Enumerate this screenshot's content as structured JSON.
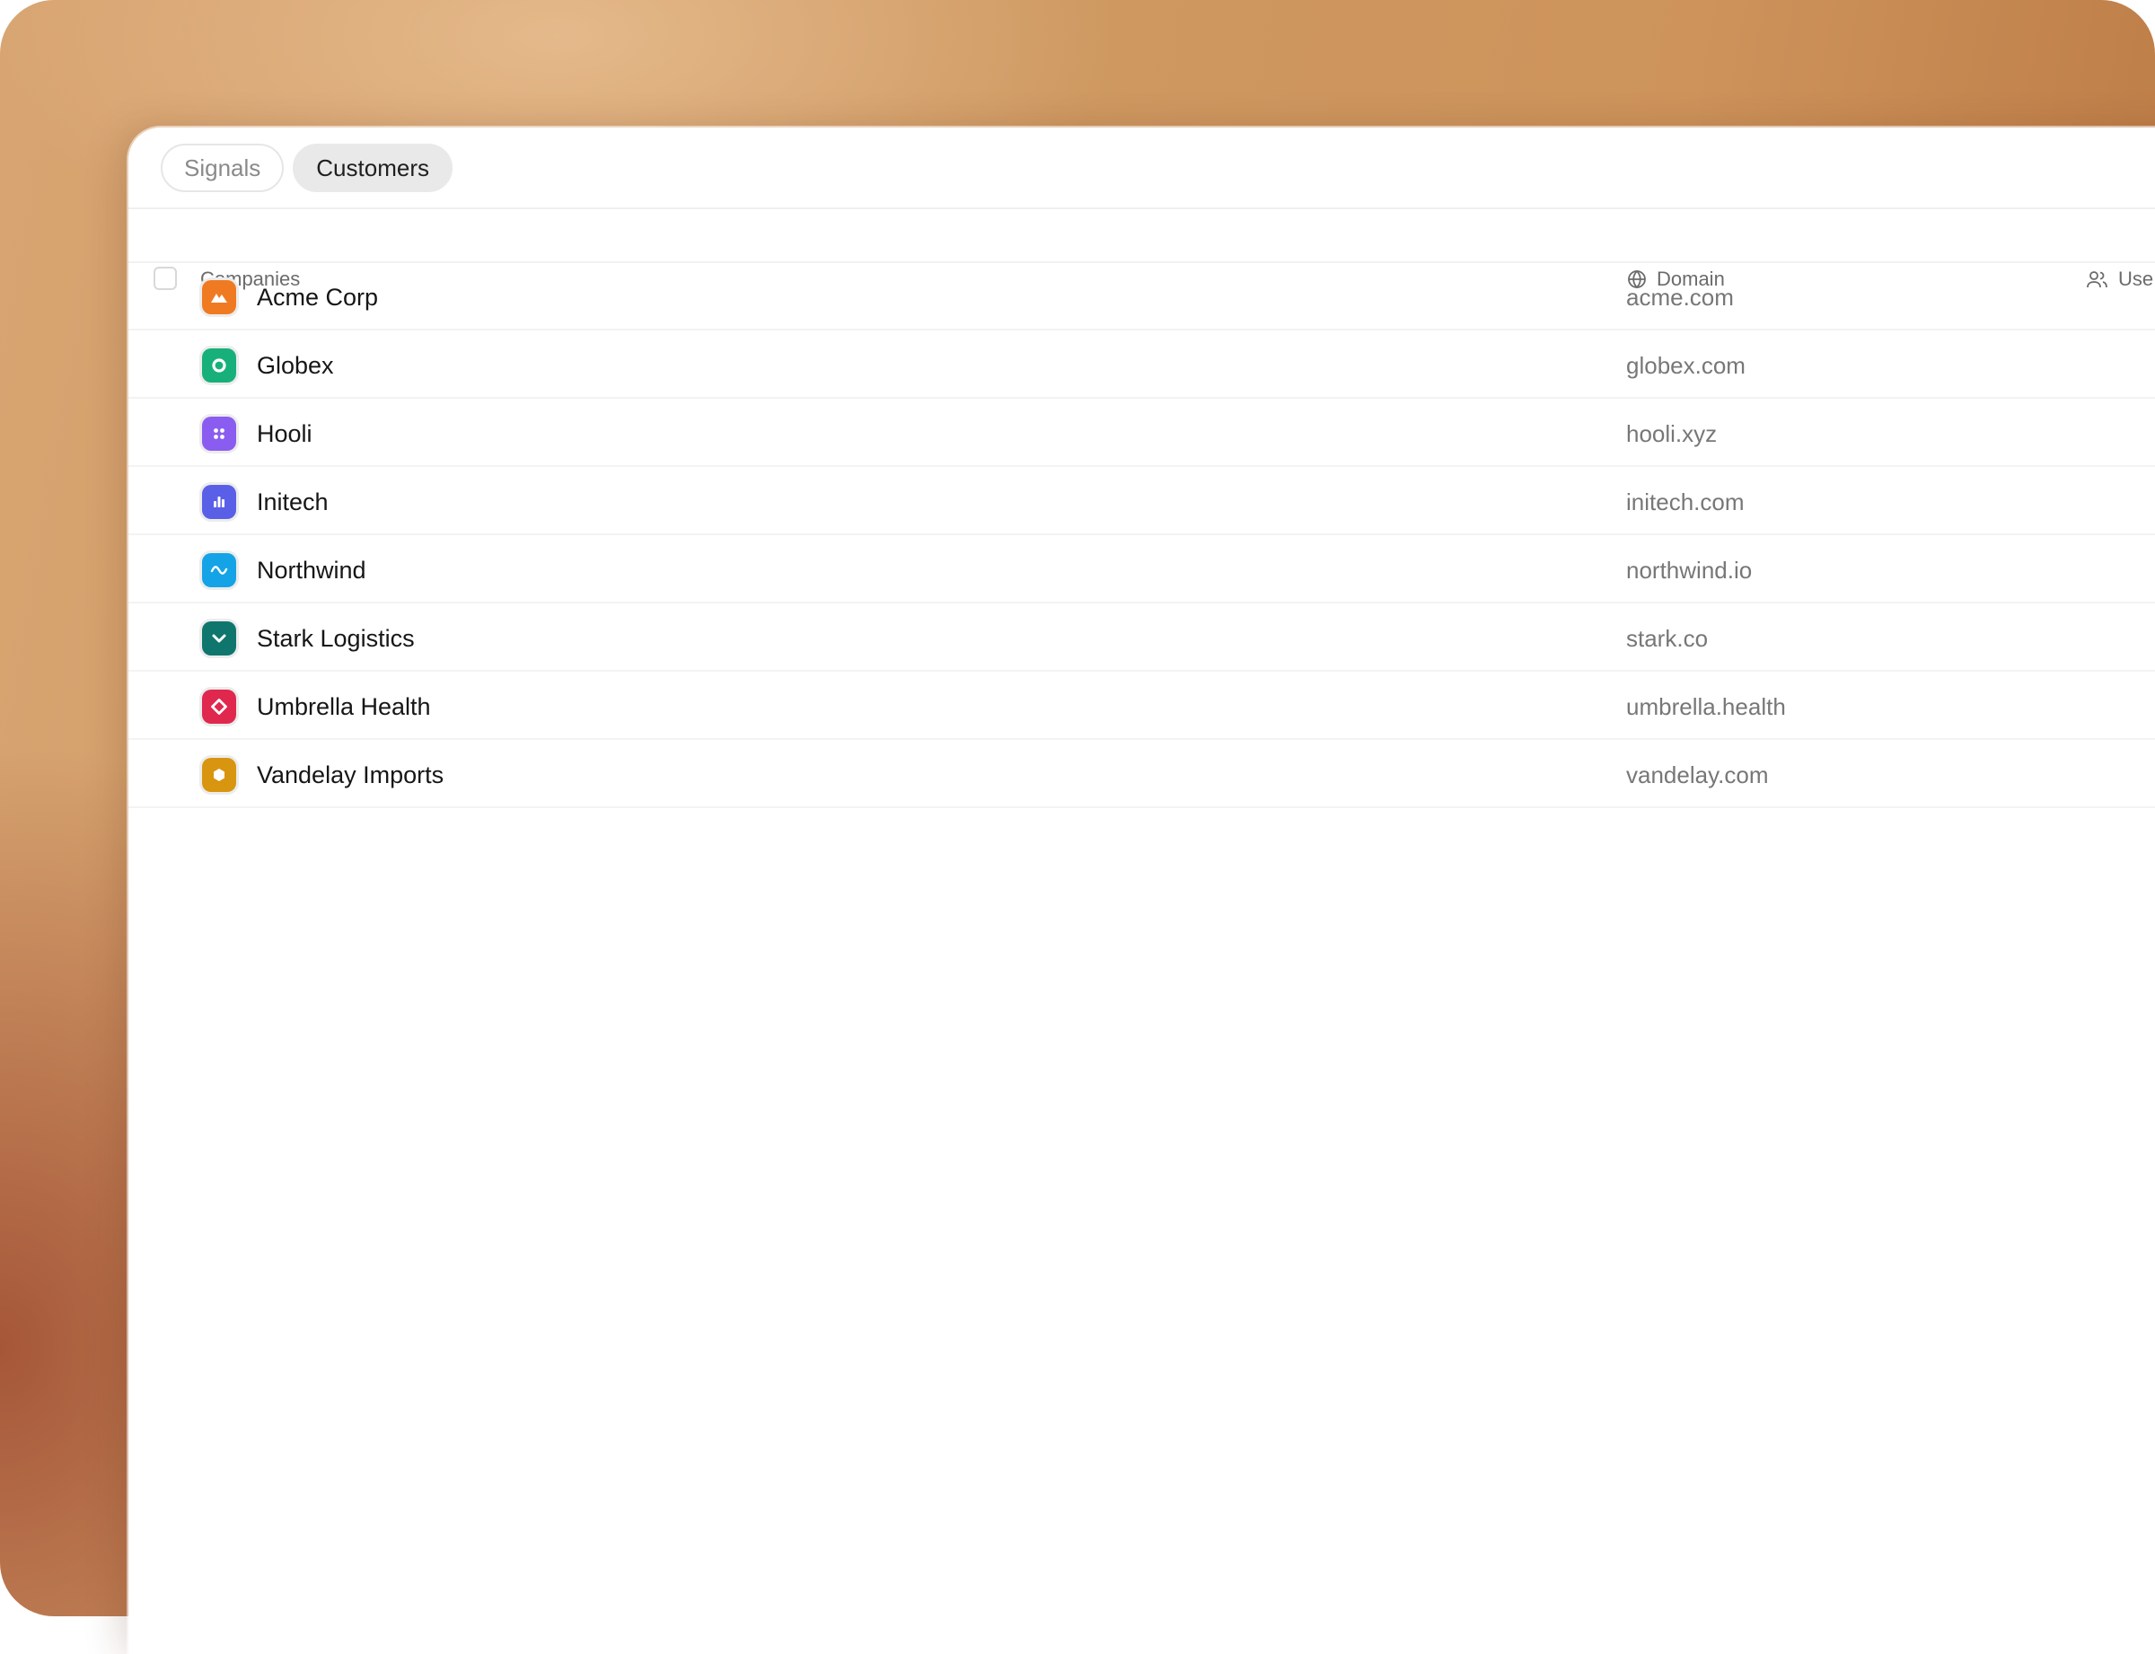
{
  "tabs": [
    {
      "label": "Signals",
      "active": false
    },
    {
      "label": "Customers",
      "active": true
    }
  ],
  "table": {
    "columns": {
      "companies": "Companies",
      "domain": "Domain",
      "users": "Use"
    },
    "rows": [
      {
        "name": "Acme Corp",
        "domain": "acme.com",
        "logo_color": "#f07a22",
        "logo_icon": "mountain-icon"
      },
      {
        "name": "Globex",
        "domain": "globex.com",
        "logo_color": "#18b07a",
        "logo_icon": "ring-icon"
      },
      {
        "name": "Hooli",
        "domain": "hooli.xyz",
        "logo_color": "#8a5cf0",
        "logo_icon": "four-dots-icon"
      },
      {
        "name": "Initech",
        "domain": "initech.com",
        "logo_color": "#5a5fe8",
        "logo_icon": "bar-chart-icon"
      },
      {
        "name": "Northwind",
        "domain": "northwind.io",
        "logo_color": "#14a3e6",
        "logo_icon": "wave-icon"
      },
      {
        "name": "Stark Logistics",
        "domain": "stark.co",
        "logo_color": "#0f766e",
        "logo_icon": "chevron-down-icon"
      },
      {
        "name": "Umbrella Health",
        "domain": "umbrella.health",
        "logo_color": "#e0284e",
        "logo_icon": "diamond-icon"
      },
      {
        "name": "Vandelay Imports",
        "domain": "vandelay.com",
        "logo_color": "#d89510",
        "logo_icon": "hexagon-icon"
      }
    ]
  }
}
